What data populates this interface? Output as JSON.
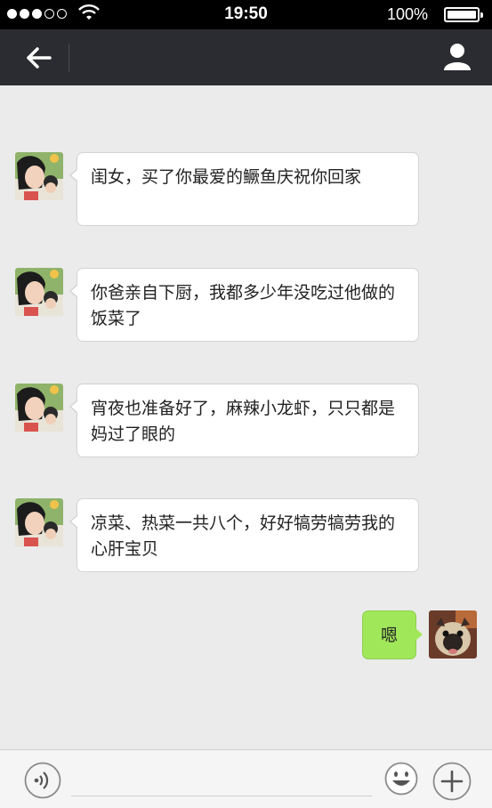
{
  "status_bar": {
    "signal_bars_filled": 3,
    "signal_bars_total": 5,
    "time": "19:50",
    "battery_percent": "100%"
  },
  "nav_bar": {
    "back_icon": "back-arrow-icon",
    "profile_icon": "person-icon"
  },
  "messages": [
    {
      "side": "in",
      "avatar": "mom-avatar",
      "text": "闺女，买了你最爱的鳜鱼庆祝你回家"
    },
    {
      "side": "in",
      "avatar": "mom-avatar",
      "text": "你爸亲自下厨，我都多少年没吃过他做的饭菜了"
    },
    {
      "side": "in",
      "avatar": "mom-avatar",
      "text": "宵夜也准备好了，麻辣小龙虾，只只都是妈过了眼的"
    },
    {
      "side": "in",
      "avatar": "mom-avatar",
      "text": "凉菜、热菜一共八个，好好犒劳犒劳我的心肝宝贝"
    },
    {
      "side": "out",
      "avatar": "pug-avatar",
      "text": "嗯"
    }
  ],
  "input_bar": {
    "voice_icon": "voice-icon",
    "placeholder": "",
    "emoji_icon": "emoji-icon",
    "plus_icon": "plus-icon"
  },
  "colors": {
    "nav_bg": "#2a2c31",
    "chat_bg": "#ebebeb",
    "incoming_bubble": "#ffffff",
    "outgoing_bubble": "#a0e75a"
  }
}
